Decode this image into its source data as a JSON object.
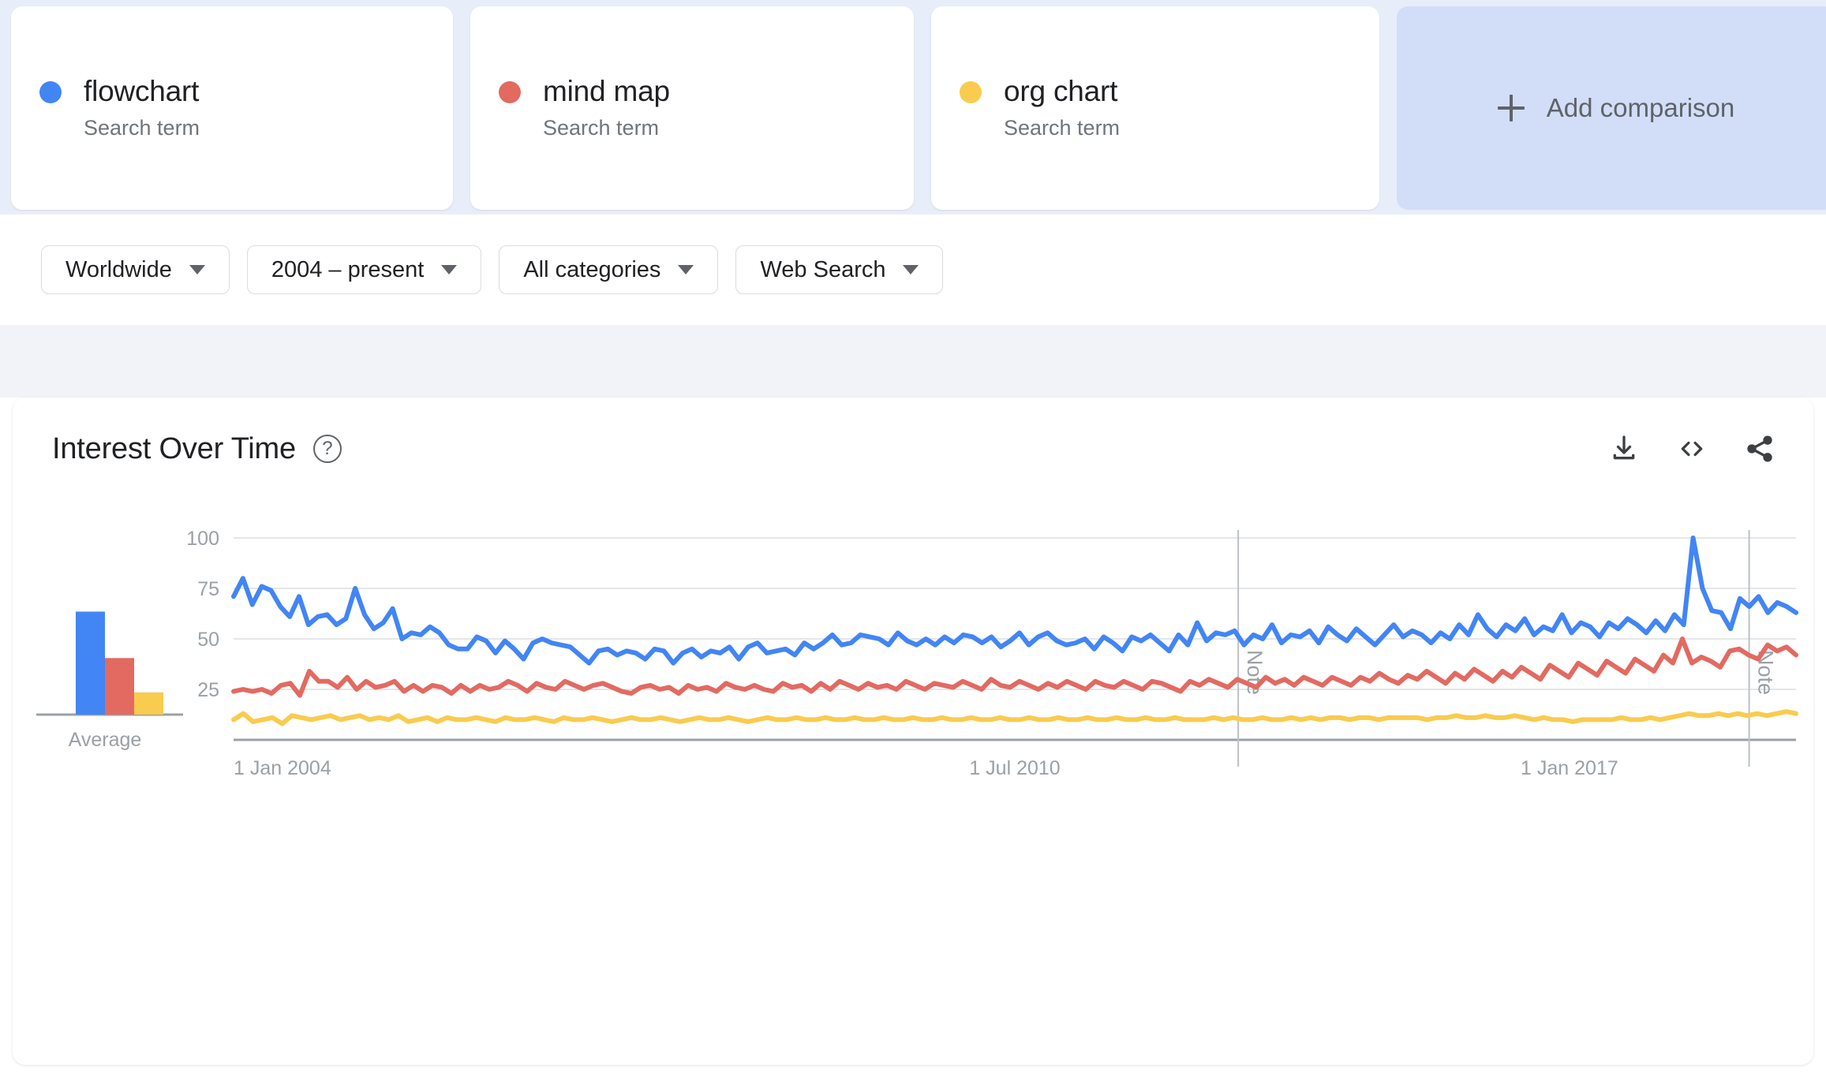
{
  "terms": [
    {
      "name": "flowchart",
      "subtitle": "Search term",
      "color": "#4285f4"
    },
    {
      "name": "mind map",
      "subtitle": "Search term",
      "color": "#e26a61"
    },
    {
      "name": "org chart",
      "subtitle": "Search term",
      "color": "#f9cb4e"
    }
  ],
  "add_comparison": {
    "label": "Add comparison",
    "icon": "plus-icon"
  },
  "filters": [
    {
      "label": "Worldwide",
      "icon": "chevron-down-icon"
    },
    {
      "label": "2004 – present",
      "icon": "chevron-down-icon"
    },
    {
      "label": "All categories",
      "icon": "chevron-down-icon"
    },
    {
      "label": "Web Search",
      "icon": "chevron-down-icon"
    }
  ],
  "card": {
    "title": "Interest Over Time",
    "help_icon": "help-circle-icon",
    "actions": [
      {
        "name": "download-icon",
        "label": "Download"
      },
      {
        "name": "embed-code-icon",
        "label": "Embed"
      },
      {
        "name": "share-icon",
        "label": "Share"
      }
    ]
  },
  "chart_data": {
    "type": "line",
    "title": "Interest Over Time",
    "xlabel": "",
    "ylabel": "",
    "ylim": [
      0,
      100
    ],
    "yticks": [
      25,
      50,
      75,
      100
    ],
    "grid": true,
    "legend": "top-cards",
    "xticks": [
      "1 Jan 2004",
      "1 Jul 2010",
      "1 Jan 2017"
    ],
    "xtick_positions": [
      0.0,
      0.5,
      0.855
    ],
    "annotations": [
      {
        "label": "Note",
        "x": 0.643
      },
      {
        "label": "Note",
        "x": 0.97
      }
    ],
    "average_panel": {
      "axis_label": "Average",
      "values": [
        51,
        28,
        11
      ],
      "colors": [
        "#4285f4",
        "#e26a61",
        "#f9cb4e"
      ]
    },
    "series": [
      {
        "name": "flowchart",
        "color": "#4285f4",
        "values": [
          71,
          80,
          67,
          76,
          74,
          66,
          61,
          71,
          57,
          61,
          62,
          57,
          60,
          75,
          62,
          55,
          58,
          65,
          50,
          53,
          52,
          56,
          53,
          47,
          45,
          45,
          51,
          49,
          43,
          49,
          45,
          40,
          48,
          50,
          48,
          47,
          46,
          42,
          38,
          44,
          45,
          42,
          44,
          43,
          40,
          45,
          44,
          38,
          43,
          45,
          41,
          44,
          43,
          46,
          40,
          46,
          48,
          43,
          44,
          45,
          42,
          48,
          45,
          48,
          52,
          47,
          48,
          52,
          51,
          50,
          47,
          53,
          49,
          47,
          50,
          47,
          51,
          48,
          52,
          51,
          48,
          51,
          46,
          49,
          53,
          47,
          51,
          53,
          49,
          47,
          48,
          50,
          45,
          51,
          48,
          44,
          51,
          49,
          52,
          48,
          44,
          52,
          47,
          58,
          49,
          53,
          52,
          54,
          47,
          52,
          50,
          57,
          48,
          52,
          51,
          54,
          48,
          56,
          52,
          49,
          55,
          51,
          47,
          52,
          57,
          51,
          54,
          52,
          48,
          53,
          50,
          57,
          52,
          62,
          55,
          51,
          57,
          54,
          60,
          52,
          56,
          54,
          62,
          53,
          58,
          56,
          51,
          58,
          55,
          60,
          57,
          53,
          59,
          54,
          62,
          57,
          100,
          75,
          64,
          63,
          55,
          70,
          66,
          71,
          63,
          68,
          66,
          63
        ]
      },
      {
        "name": "mind map",
        "color": "#e26a61",
        "values": [
          24,
          25,
          24,
          25,
          23,
          27,
          28,
          22,
          34,
          29,
          29,
          26,
          31,
          25,
          29,
          26,
          27,
          29,
          24,
          27,
          24,
          27,
          26,
          23,
          27,
          24,
          27,
          25,
          26,
          29,
          27,
          24,
          28,
          26,
          25,
          29,
          27,
          25,
          27,
          28,
          26,
          24,
          23,
          26,
          27,
          25,
          26,
          23,
          27,
          25,
          26,
          24,
          28,
          26,
          25,
          27,
          25,
          24,
          28,
          26,
          27,
          24,
          28,
          25,
          29,
          27,
          25,
          28,
          26,
          27,
          25,
          29,
          27,
          25,
          28,
          27,
          26,
          29,
          27,
          25,
          30,
          27,
          26,
          29,
          27,
          25,
          28,
          26,
          29,
          27,
          25,
          29,
          27,
          26,
          29,
          27,
          25,
          29,
          28,
          26,
          24,
          29,
          27,
          30,
          28,
          26,
          30,
          28,
          26,
          31,
          28,
          30,
          27,
          31,
          29,
          27,
          31,
          29,
          27,
          31,
          29,
          33,
          30,
          28,
          32,
          30,
          34,
          31,
          28,
          33,
          30,
          35,
          32,
          29,
          34,
          31,
          36,
          33,
          30,
          37,
          34,
          31,
          38,
          35,
          32,
          39,
          36,
          33,
          40,
          37,
          34,
          42,
          38,
          50,
          38,
          41,
          39,
          36,
          44,
          45,
          42,
          40,
          47,
          44,
          46,
          42
        ]
      },
      {
        "name": "org chart",
        "color": "#f9cb4e",
        "values": [
          10,
          13,
          9,
          10,
          11,
          8,
          12,
          11,
          10,
          11,
          12,
          10,
          11,
          12,
          10,
          11,
          10,
          12,
          9,
          10,
          11,
          9,
          11,
          10,
          10,
          11,
          10,
          9,
          11,
          10,
          10,
          11,
          10,
          9,
          11,
          10,
          10,
          11,
          10,
          9,
          10,
          11,
          10,
          10,
          11,
          10,
          9,
          10,
          11,
          10,
          10,
          11,
          10,
          9,
          10,
          11,
          10,
          10,
          11,
          10,
          10,
          11,
          10,
          10,
          11,
          10,
          10,
          11,
          10,
          10,
          11,
          10,
          10,
          11,
          10,
          10,
          11,
          10,
          10,
          11,
          10,
          10,
          11,
          10,
          10,
          11,
          10,
          10,
          11,
          10,
          10,
          11,
          10,
          10,
          11,
          10,
          10,
          11,
          10,
          10,
          10,
          11,
          10,
          11,
          10,
          10,
          11,
          10,
          10,
          11,
          10,
          11,
          10,
          11,
          11,
          10,
          11,
          11,
          10,
          11,
          11,
          11,
          11,
          10,
          11,
          11,
          12,
          11,
          11,
          12,
          11,
          11,
          12,
          11,
          10,
          11,
          10,
          10,
          9,
          10,
          10,
          10,
          10,
          11,
          10,
          10,
          11,
          10,
          11,
          12,
          13,
          12,
          12,
          13,
          12,
          13,
          12,
          13,
          12,
          13,
          14,
          13
        ]
      }
    ]
  }
}
